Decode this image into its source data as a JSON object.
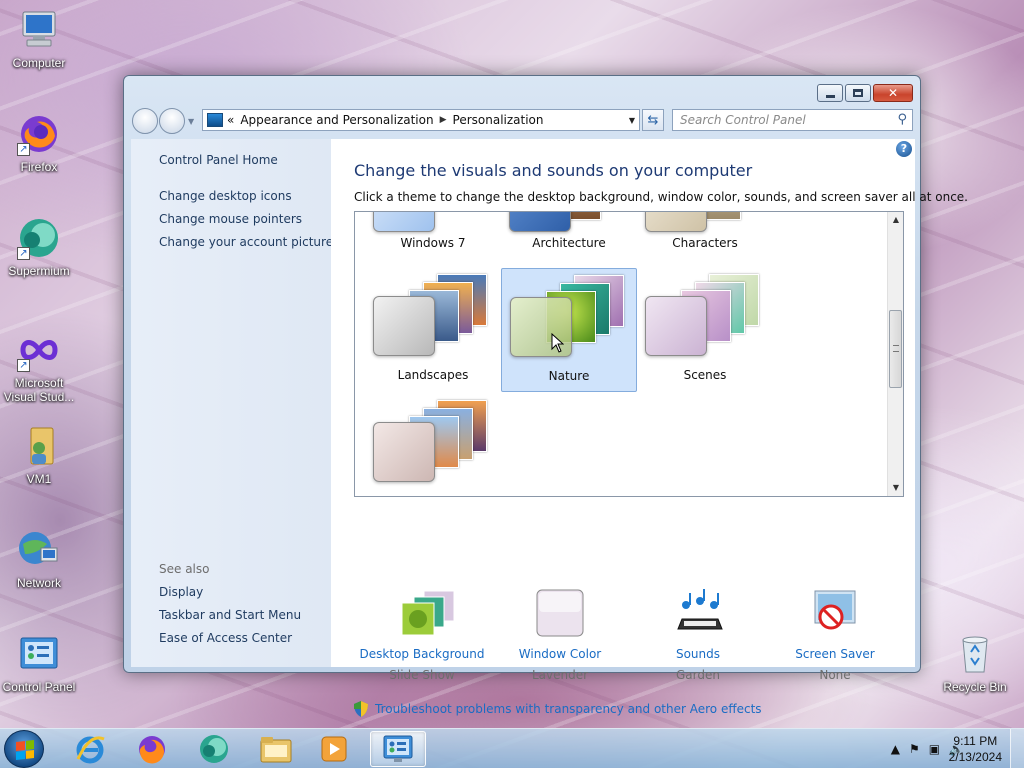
{
  "desktop": {
    "icons": [
      {
        "label": "Computer"
      },
      {
        "label": "Firefox"
      },
      {
        "label": "Supermium"
      },
      {
        "label": "Microsoft Visual Stud..."
      },
      {
        "label": "VM1"
      },
      {
        "label": "Network"
      },
      {
        "label": "Control Panel"
      },
      {
        "label": "Recycle Bin"
      }
    ]
  },
  "window": {
    "address": {
      "overflow": "«",
      "segments": [
        "Appearance and Personalization",
        "Personalization"
      ]
    },
    "search_placeholder": "Search Control Panel",
    "left_pane": {
      "home": "Control Panel Home",
      "links": [
        "Change desktop icons",
        "Change mouse pointers",
        "Change your account picture"
      ],
      "see_also_label": "See also",
      "see_also": [
        "Display",
        "Taskbar and Start Menu",
        "Ease of Access Center"
      ]
    },
    "title": "Change the visuals and sounds on your computer",
    "subtitle": "Click a theme to change the desktop background, window color, sounds, and screen saver all at once.",
    "themes": [
      {
        "label": "Windows 7"
      },
      {
        "label": "Architecture"
      },
      {
        "label": "Characters"
      },
      {
        "label": "Landscapes"
      },
      {
        "label": "Nature",
        "selected": true
      },
      {
        "label": "Scenes"
      },
      {
        "label": ""
      }
    ],
    "options": [
      {
        "link": "Desktop Background",
        "value": "Slide Show"
      },
      {
        "link": "Window Color",
        "value": "Lavender"
      },
      {
        "link": "Sounds",
        "value": "Garden"
      },
      {
        "link": "Screen Saver",
        "value": "None"
      }
    ],
    "troubleshoot": "Troubleshoot problems with transparency and other Aero effects"
  },
  "taskbar": {
    "apps": [
      "internet-explorer",
      "firefox",
      "supermium",
      "file-explorer",
      "media-player",
      "control-panel"
    ],
    "active_app": "control-panel",
    "clock_time": "9:11 PM",
    "clock_date": "2/13/2024"
  },
  "colors": {
    "link": "#1a6cc4",
    "title": "#1e3a74",
    "selection": "#cfe3fb"
  }
}
